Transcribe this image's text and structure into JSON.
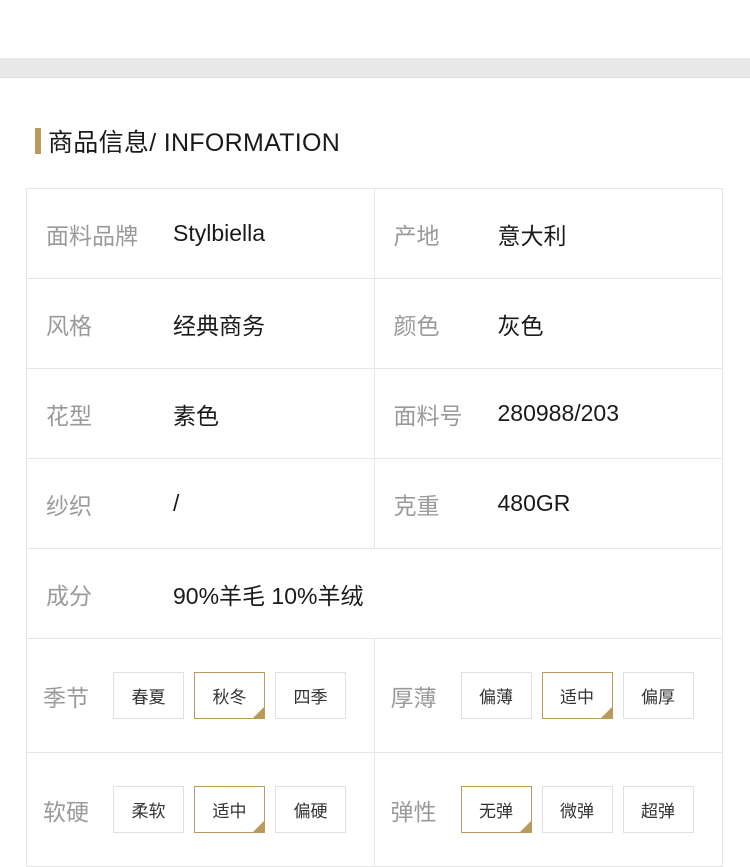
{
  "colors": {
    "accent": "#b99a5a",
    "band": "#e8e8e8",
    "label": "#9a9a9a",
    "text": "#1a1a1a",
    "border": "#e6e6e6"
  },
  "section": {
    "title": "商品信息/ INFORMATION"
  },
  "rows": [
    {
      "left": {
        "label": "面料品牌",
        "value": "Stylbiella"
      },
      "right": {
        "label": "产地",
        "value": "意大利"
      }
    },
    {
      "left": {
        "label": "风格",
        "value": "经典商务"
      },
      "right": {
        "label": "颜色",
        "value": "灰色"
      }
    },
    {
      "left": {
        "label": "花型",
        "value": "素色"
      },
      "right": {
        "label": "面料号",
        "value": "280988/203"
      }
    },
    {
      "left": {
        "label": "纱织",
        "value": "/"
      },
      "right": {
        "label": "克重",
        "value": "480GR"
      }
    }
  ],
  "composition": {
    "label": "成分",
    "value": "90%羊毛 10%羊绒"
  },
  "attributes": {
    "season": {
      "label": "季节",
      "options": [
        "春夏",
        "秋冬",
        "四季"
      ],
      "selected": "秋冬"
    },
    "thickness": {
      "label": "厚薄",
      "options": [
        "偏薄",
        "适中",
        "偏厚"
      ],
      "selected": "适中"
    },
    "hardness": {
      "label": "软硬",
      "options": [
        "柔软",
        "适中",
        "偏硬"
      ],
      "selected": "适中"
    },
    "elasticity": {
      "label": "弹性",
      "options": [
        "无弹",
        "微弹",
        "超弹"
      ],
      "selected": "无弹"
    }
  }
}
